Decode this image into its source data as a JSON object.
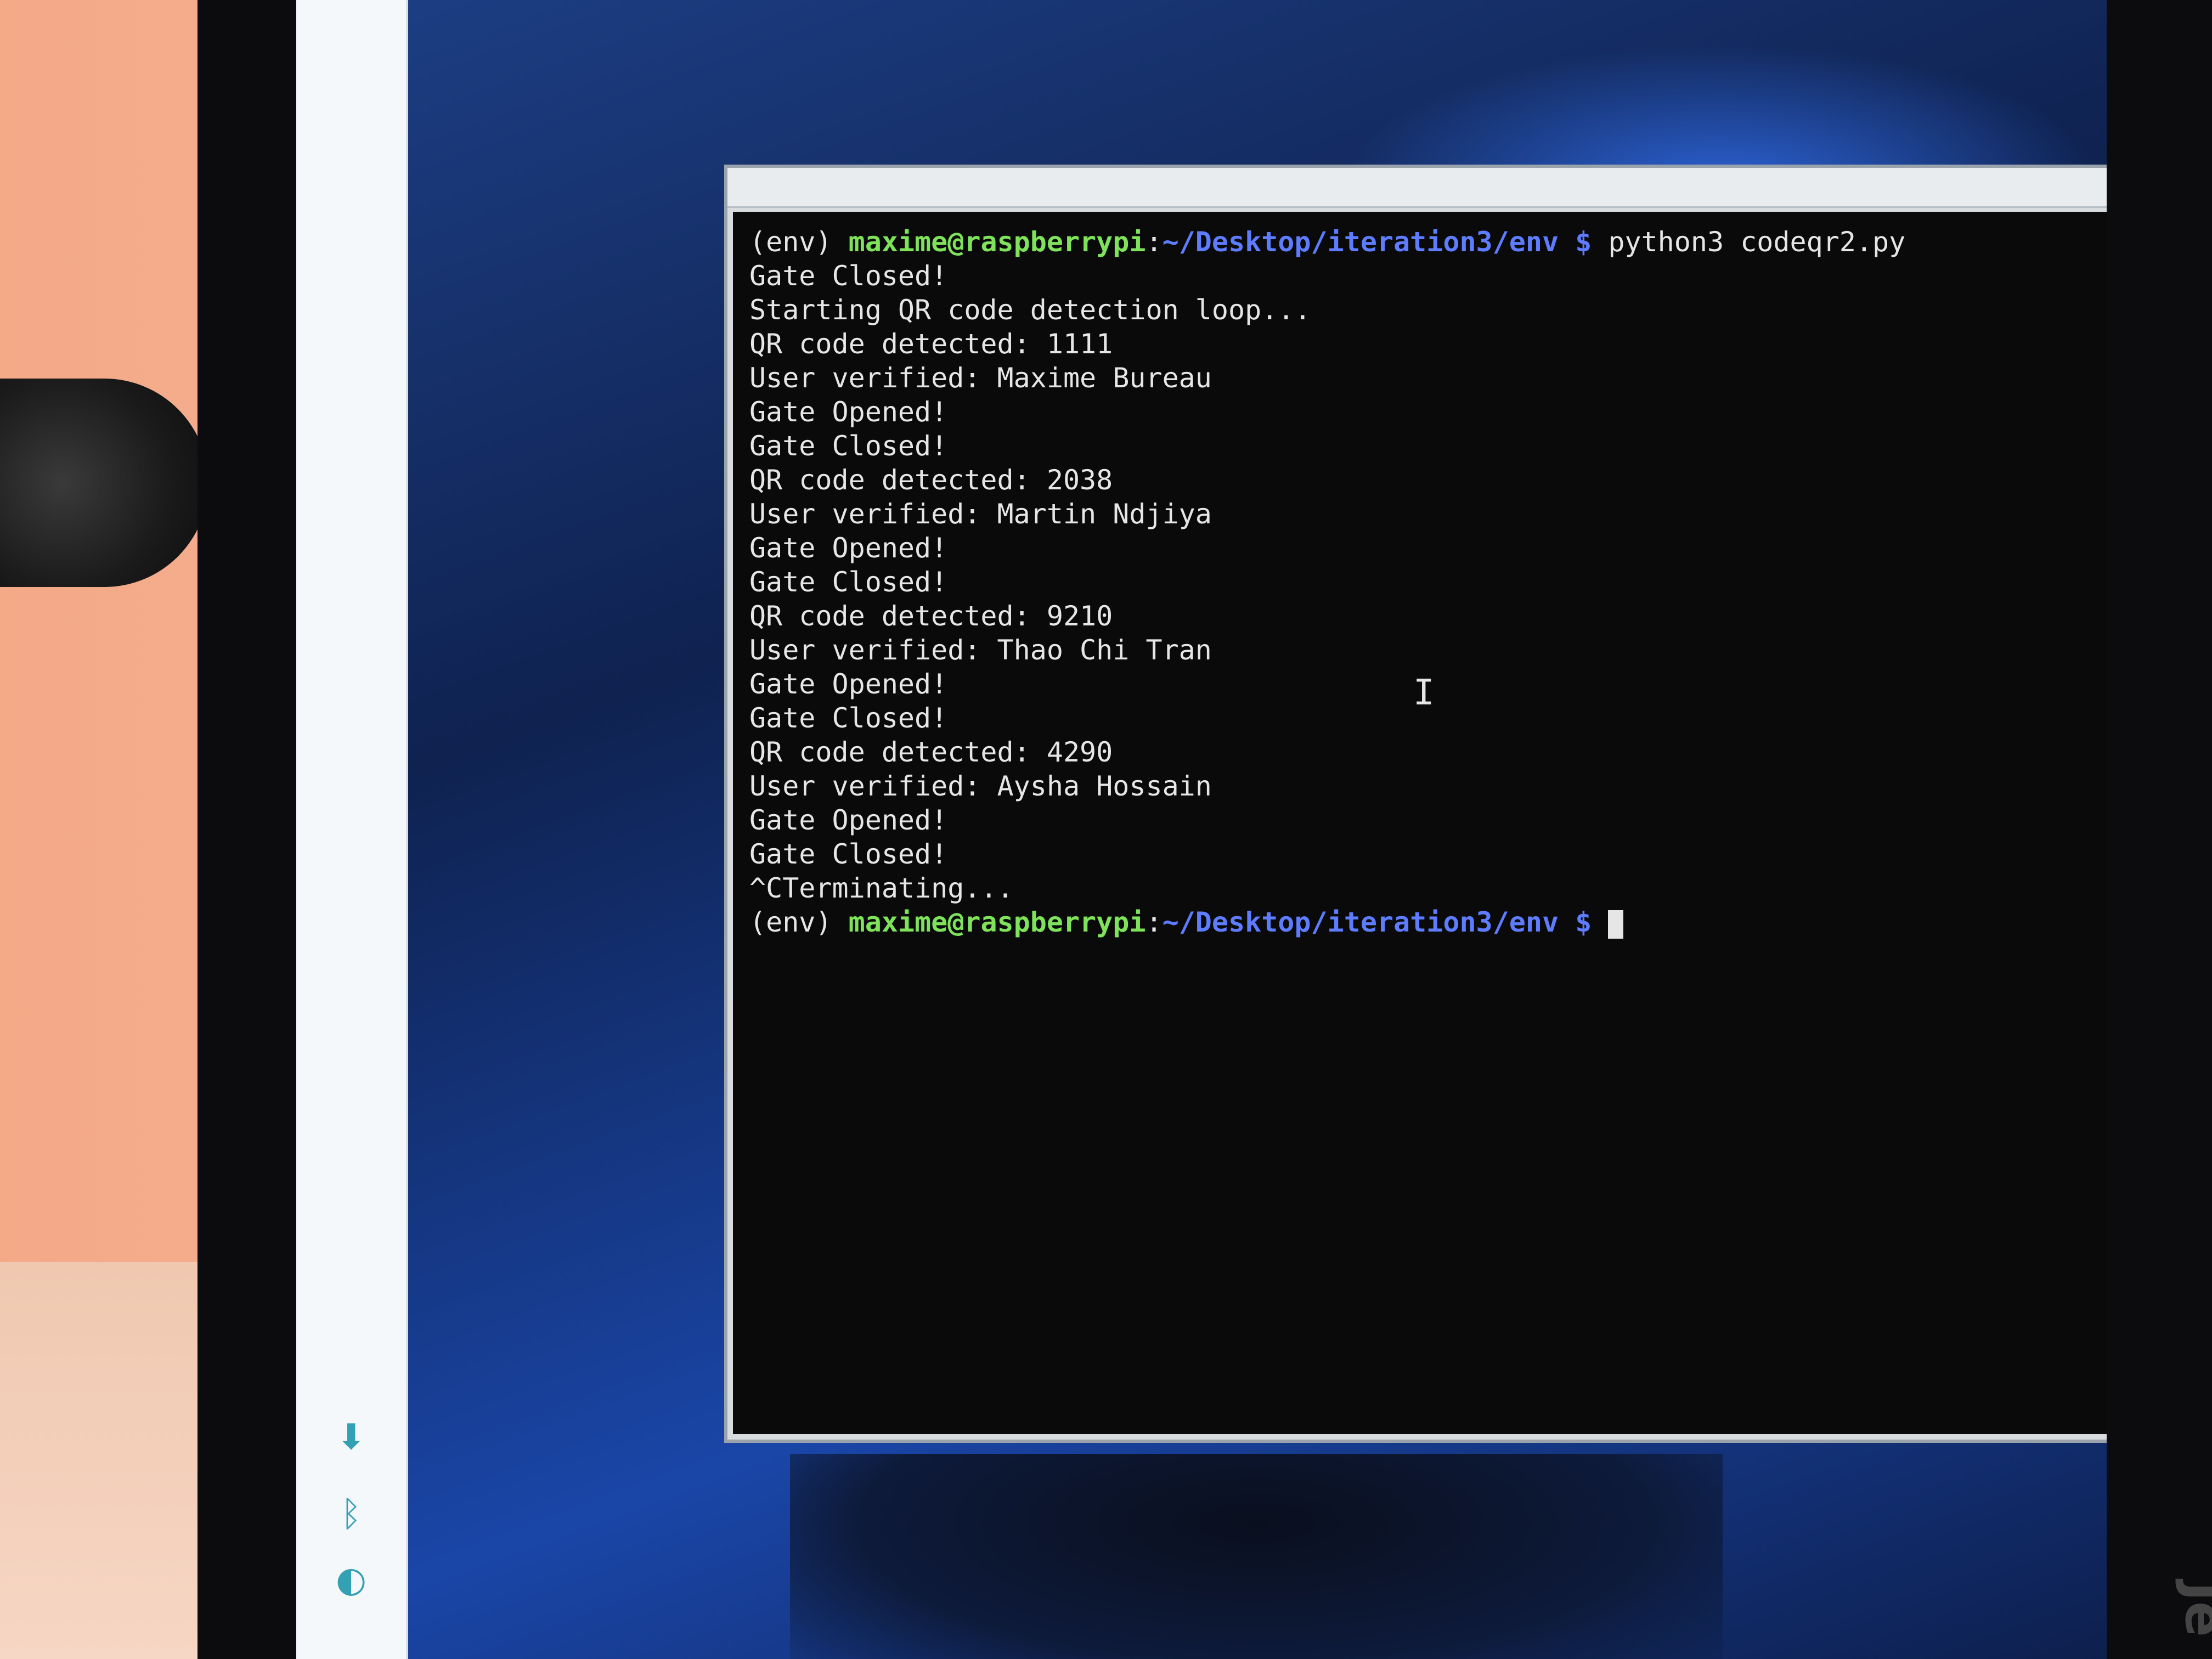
{
  "terminal": {
    "window_title": "",
    "lines": [
      {
        "type": "prompt",
        "env": "(env) ",
        "user": "maxime@raspberrypi",
        "sep": ":",
        "path": "~/Desktop/iteration3/env",
        "dollar": " $ ",
        "command": "python3 codeqr2.py"
      },
      {
        "type": "output",
        "text": "Gate Closed!"
      },
      {
        "type": "output",
        "text": "Starting QR code detection loop..."
      },
      {
        "type": "output",
        "text": "QR code detected: 1111"
      },
      {
        "type": "output",
        "text": "User verified: Maxime Bureau"
      },
      {
        "type": "output",
        "text": "Gate Opened!"
      },
      {
        "type": "output",
        "text": "Gate Closed!"
      },
      {
        "type": "output",
        "text": "QR code detected: 2038"
      },
      {
        "type": "output",
        "text": "User verified: Martin Ndjiya"
      },
      {
        "type": "output",
        "text": "Gate Opened!"
      },
      {
        "type": "output",
        "text": "Gate Closed!"
      },
      {
        "type": "output",
        "text": "QR code detected: 9210"
      },
      {
        "type": "output",
        "text": "User verified: Thao Chi Tran"
      },
      {
        "type": "output",
        "text": "Gate Opened!"
      },
      {
        "type": "output",
        "text": "Gate Closed!"
      },
      {
        "type": "output",
        "text": "QR code detected: 4290"
      },
      {
        "type": "output",
        "text": "User verified: Aysha Hossain"
      },
      {
        "type": "output",
        "text": "Gate Opened!"
      },
      {
        "type": "output",
        "text": "Gate Closed!"
      },
      {
        "type": "output",
        "text": "^CTerminating..."
      },
      {
        "type": "prompt",
        "env": "(env) ",
        "user": "maxime@raspberrypi",
        "sep": ":",
        "path": "~/Desktop/iteration3/env",
        "dollar": " $ ",
        "command": ""
      }
    ]
  },
  "taskbar": {
    "icons": [
      "wifi-icon",
      "bluetooth-icon",
      "update-icon"
    ]
  },
  "colors": {
    "prompt_user": "#7ee35a",
    "prompt_path": "#5d7cff",
    "terminal_bg": "#0a0a0a",
    "terminal_fg": "#e6e6e6"
  }
}
